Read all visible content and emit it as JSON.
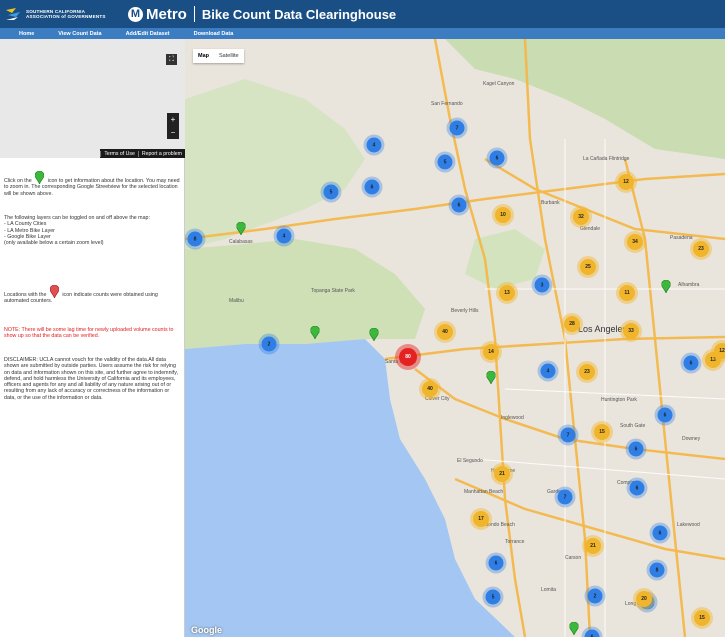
{
  "header": {
    "scag_text": "SOUTHERN CALIFORNIA ASSOCIATION of GOVERNMENTS",
    "metro_letter": "M",
    "metro_word": "Metro",
    "title": "Bike Count Data Clearinghouse"
  },
  "nav": [
    {
      "label": "Home"
    },
    {
      "label": "View Count Data"
    },
    {
      "label": "Add/Edit Dataset"
    },
    {
      "label": "Download Data"
    }
  ],
  "streetview": {
    "terms": "Terms of Use",
    "report": "Report a problem",
    "zoom_in": "+",
    "zoom_out": "−",
    "fullscreen": "⛶"
  },
  "sidebar": {
    "p1_before": "Click on the",
    "p1_after": "icon to get information about the location. You may need to zoom in. The corresponding Google Streetview for the selected location will be shown above.",
    "p2": "The following layers can be toggled on and off above the map:",
    "p2_l1": "- LA County Cities",
    "p2_l2": "- LA Metro Bike Layer",
    "p2_l3": "- Google Bike Layer",
    "p2_l4": "(only available below a certain zoom level)",
    "p3_before": "Locations with the",
    "p3_after": "icon indicate counts were obtained using automated counters.",
    "note": "NOTE: There will be some lag time for newly uploaded volume counts to show up so that the data can be verified.",
    "disclaimer": "DISCLAIMER: UCLA cannot vouch for the validity of the data.All data shown are submitted by outside parties. Users assume the risk for relying on data and information shown on this site, and further agree to indemnify, defend, and hold harmless the University of California and its employees, officers and agents for any and all liability of any nature arising out of or resulting from any lack of accuracy or correctness of the information or data, or the use of the information or data."
  },
  "map": {
    "type_map": "Map",
    "type_satellite": "Satellite",
    "google": "Google",
    "towns": {
      "san_fernando": "San Fernando",
      "kagel": "Kagel Canyon",
      "burbank": "Burbank",
      "pasadena": "Pasadena",
      "la": "Los Angeles",
      "beverly": "Beverly Hills",
      "santa_monica": "Santa Monica",
      "inglewood": "Inglewood",
      "hawthorne": "Hawthorne",
      "torrance": "Torrance",
      "long_beach": "Long Beach",
      "calabasas": "Calabasas",
      "malibu": "Malibu",
      "huntington": "Huntington Park",
      "south_gate": "South Gate",
      "downey": "Downey",
      "compton": "Compton",
      "el_segundo": "El Segundo",
      "gardena": "Gardena",
      "la_canada": "La Cañada Flintridge",
      "glendale": "Glendale",
      "alhambra": "Alhambra",
      "topanga": "Topanga State Park",
      "lakewood": "Lakewood",
      "culver": "Culver City",
      "carson": "Carson",
      "manhattan": "Manhattan Beach",
      "redondo": "Redondo Beach",
      "lomita": "Lomita"
    },
    "clusters": [
      {
        "c": "b",
        "n": "7"
      },
      {
        "c": "b",
        "n": "4"
      },
      {
        "c": "b",
        "n": "5"
      },
      {
        "c": "b",
        "n": "6"
      },
      {
        "c": "b",
        "n": "5"
      },
      {
        "c": "b",
        "n": "6"
      },
      {
        "c": "b",
        "n": "6"
      },
      {
        "c": "b",
        "n": "4"
      },
      {
        "c": "b",
        "n": "8"
      },
      {
        "c": "b",
        "n": "3"
      },
      {
        "c": "b",
        "n": "2"
      },
      {
        "c": "b",
        "n": "4"
      },
      {
        "c": "b",
        "n": "6"
      },
      {
        "c": "b",
        "n": "6"
      },
      {
        "c": "b",
        "n": "7"
      },
      {
        "c": "b",
        "n": "6"
      },
      {
        "c": "b",
        "n": "6"
      },
      {
        "c": "b",
        "n": "7"
      },
      {
        "c": "b",
        "n": "6"
      },
      {
        "c": "b",
        "n": "8"
      },
      {
        "c": "b",
        "n": "6"
      },
      {
        "c": "b",
        "n": "2"
      },
      {
        "c": "b",
        "n": "5"
      },
      {
        "c": "b",
        "n": "6"
      },
      {
        "c": "b",
        "n": "2"
      },
      {
        "c": "y",
        "n": "12"
      },
      {
        "c": "y",
        "n": "10"
      },
      {
        "c": "y",
        "n": "32"
      },
      {
        "c": "y",
        "n": "34"
      },
      {
        "c": "y",
        "n": "25"
      },
      {
        "c": "y",
        "n": "23"
      },
      {
        "c": "y",
        "n": "13"
      },
      {
        "c": "y",
        "n": "11"
      },
      {
        "c": "y",
        "n": "28"
      },
      {
        "c": "y",
        "n": "40"
      },
      {
        "c": "y",
        "n": "14"
      },
      {
        "c": "y",
        "n": "23"
      },
      {
        "c": "y",
        "n": "40"
      },
      {
        "c": "y",
        "n": "13"
      },
      {
        "c": "y",
        "n": "15"
      },
      {
        "c": "y",
        "n": "21"
      },
      {
        "c": "y",
        "n": "17"
      },
      {
        "c": "y",
        "n": "21"
      },
      {
        "c": "y",
        "n": "20"
      },
      {
        "c": "y",
        "n": "15"
      },
      {
        "c": "y",
        "n": "12"
      },
      {
        "c": "y",
        "n": "33"
      },
      {
        "c": "r",
        "n": "80"
      }
    ]
  },
  "colors": {
    "header": "#1a4f86",
    "nav": "#3c7dc2",
    "cluster_blue": "#2f7ee5",
    "cluster_yellow": "#f1b52c",
    "cluster_red": "#e52222",
    "marker_green": "#3cb83c",
    "marker_red": "#e05050",
    "note_red": "#e02020",
    "water": "#a3c7f2"
  },
  "icons": [
    "scag-logo-icon",
    "metro-logo-icon",
    "fullscreen-icon",
    "green-marker-icon",
    "red-marker-icon"
  ]
}
